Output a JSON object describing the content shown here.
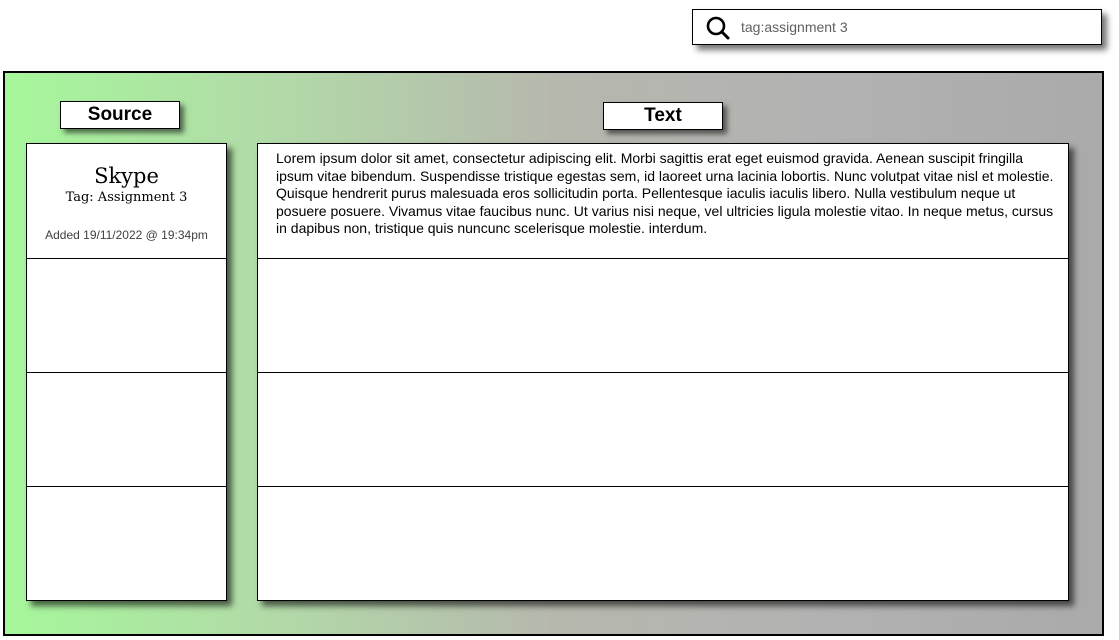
{
  "search": {
    "value": "tag:assignment 3",
    "icon": "search-icon"
  },
  "headers": {
    "source": "Source",
    "text": "Text"
  },
  "rows": [
    {
      "source_name": "Skype",
      "source_tag": "Tag: Assignment 3",
      "added": "Added 19/11/2022 @ 19:34pm",
      "text": "Lorem ipsum dolor sit amet, consectetur adipiscing elit. Morbi sagittis erat eget euismod gravida. Aenean suscipit fringilla ipsum vitae bibendum. Suspendisse tristique egestas sem, id laoreet urna lacinia lobortis. Nunc volutpat vitae nisl et molestie. Quisque hendrerit purus malesuada eros sollicitudin porta. Pellentesque iaculis iaculis libero. Nulla vestibulum neque ut posuere posuere. Vivamus vitae faucibus nunc. Ut varius nisi neque, vel ultricies ligula molestie vitao. In neque metus, cursus in dapibus non, tristique quis nuncunc scelerisque molestie. interdum."
    },
    {
      "source_name": "",
      "source_tag": "",
      "added": "",
      "text": ""
    },
    {
      "source_name": "",
      "source_tag": "",
      "added": "",
      "text": ""
    },
    {
      "source_name": "",
      "source_tag": "",
      "added": "",
      "text": ""
    }
  ],
  "colors": {
    "gradient_start": "#a6f79b",
    "gradient_end": "#aaaaaa"
  }
}
